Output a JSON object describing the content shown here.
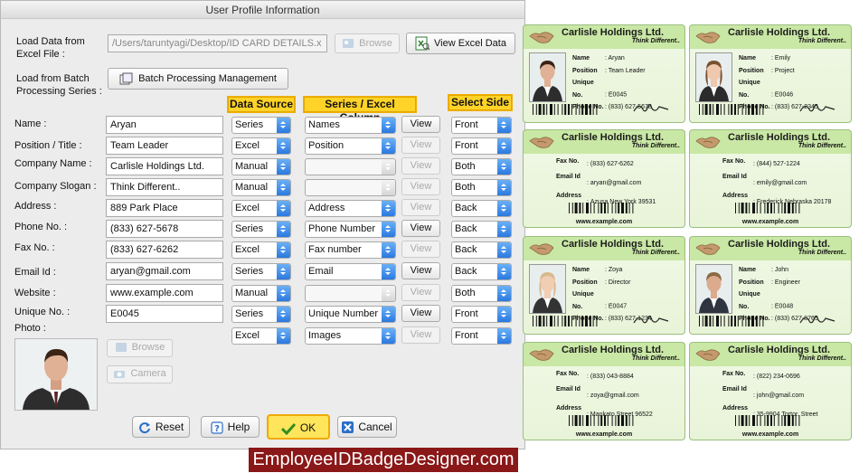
{
  "window": {
    "title": "User Profile Information"
  },
  "load": {
    "excel_label": "Load Data from\nExcel File :",
    "excel_path": "/Users/taruntyagi/Desktop/ID CARD DETAILS.x",
    "browse": "Browse",
    "view_excel": "View Excel Data",
    "batch_label": "Load from Batch\nProcessing Series :",
    "batch_button": "Batch Processing Management"
  },
  "headers": {
    "source": "Data Source",
    "series": "Series / Excel Column",
    "side": "Select Side"
  },
  "view_label": "View",
  "fields": [
    {
      "label": "Name :",
      "value": "Aryan",
      "source": "Series",
      "column": "Names",
      "view_enabled": true,
      "side": "Front"
    },
    {
      "label": "Position / Title :",
      "value": "Team Leader",
      "source": "Excel",
      "column": "Position",
      "view_enabled": false,
      "side": "Front"
    },
    {
      "label": "Company Name :",
      "value": "Carlisle Holdings Ltd.",
      "source": "Manual",
      "column": "",
      "view_enabled": false,
      "side": "Both"
    },
    {
      "label": "Company Slogan :",
      "value": "Think Different..",
      "source": "Manual",
      "column": "",
      "view_enabled": false,
      "side": "Both"
    },
    {
      "label": "Address :",
      "value": "889 Park Place",
      "source": "Excel",
      "column": "Address",
      "view_enabled": false,
      "side": "Back"
    },
    {
      "label": "Phone No. :",
      "value": "(833) 627-5678",
      "source": "Series",
      "column": "Phone Number",
      "view_enabled": true,
      "side": "Back"
    },
    {
      "label": "Fax No. :",
      "value": "(833) 627-6262",
      "source": "Excel",
      "column": "Fax number",
      "view_enabled": false,
      "side": "Back"
    },
    {
      "label": "Email Id :",
      "value": "aryan@gmail.com",
      "source": "Series",
      "column": "Email",
      "view_enabled": true,
      "side": "Back"
    },
    {
      "label": "Website :",
      "value": "www.example.com",
      "source": "Manual",
      "column": "",
      "view_enabled": false,
      "side": "Both"
    },
    {
      "label": "Unique No. :",
      "value": "E0045",
      "source": "Series",
      "column": "Unique Number",
      "view_enabled": true,
      "side": "Front"
    },
    {
      "label": "Photo :",
      "value": "",
      "source": "Excel",
      "column": "Images",
      "view_enabled": false,
      "side": "Front"
    }
  ],
  "photo": {
    "browse": "Browse",
    "camera": "Camera"
  },
  "actions": {
    "reset": "Reset",
    "help": "Help",
    "ok": "OK",
    "cancel": "Cancel"
  },
  "footer": "EmployeeIDBadgeDesigner.com",
  "cards": {
    "company": "Carlisle Holdings Ltd.",
    "slogan": "Think Different..",
    "url": "www.example.com",
    "labels": {
      "name": "Name",
      "position": "Position",
      "unique": "Unique No.",
      "phone": "Phone No.",
      "fax": "Fax No.",
      "email": "Email Id",
      "address": "Address"
    },
    "front": [
      {
        "name": "Aryan",
        "position": "Team Leader",
        "unique": "E0045",
        "phone": "(833) 627-5678"
      },
      {
        "name": "Emily",
        "position": "Project",
        "unique": "E0046",
        "phone": "(833) 627-2345"
      },
      {
        "name": "Zoya",
        "position": "Director",
        "unique": "E0047",
        "phone": "(833) 627-1234"
      },
      {
        "name": "John",
        "position": "Engineer",
        "unique": "E0048",
        "phone": "(833) 627-8765"
      }
    ],
    "back": [
      {
        "fax": "(833) 627-6262",
        "email": "aryan@gmail.com",
        "address": "Azusa New York 39531"
      },
      {
        "fax": "(844) 527-1224",
        "email": "emily@gmail.com",
        "address": "Frederick Nebraska 20178"
      },
      {
        "fax": "(833) 043-8884",
        "email": "zoya@gmail.com",
        "address": "Mankato Street 96522"
      },
      {
        "fax": "(822) 234-0696",
        "email": "john@gmail.com",
        "address": "35-9904 Tortor. Street"
      }
    ]
  },
  "colors": {
    "header_yellow": "#ffd327",
    "ok_yellow": "#ffe55c",
    "footer_red": "#8a1818",
    "card_green": "#c9e7a5",
    "select_blue": "#2b79e0"
  }
}
